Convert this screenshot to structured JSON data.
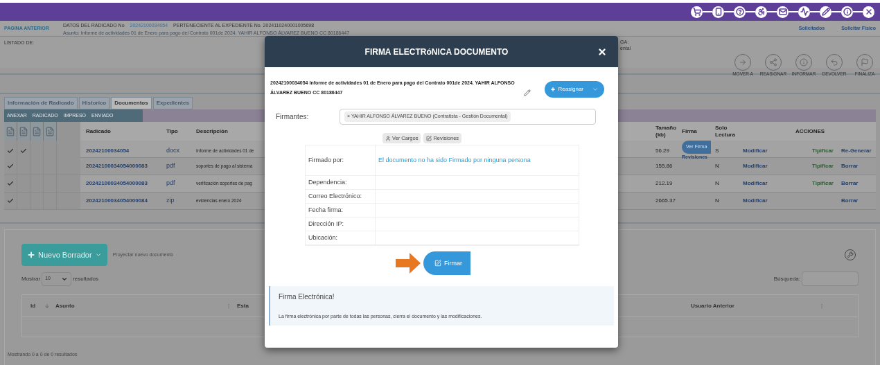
{
  "header": {
    "back_link": "PAGINA ANTERIOR",
    "radicado_label": "DATOS DEL RADICADO No",
    "radicado_number": "20242100034054",
    "expediente": "PERTENECIENTE AL EXPEDIENTE No. 2024110240001005698",
    "asunto": "Asunto: Informe de actividades 01 de Enero para pago del Contrato 001de 2024. YAHIR ALFONSO ÁLVAREZ BUENO CC 80186447",
    "links": [
      "Solicitados",
      "Solicitar Físico"
    ]
  },
  "listado": {
    "label": "LISTADO DE:",
    "info_label": "GA:",
    "info_value": "ental"
  },
  "workflow": [
    "MOVER A",
    "REASIGNAR",
    "INFORMAR",
    "DEVOLVER",
    "FINALIZA"
  ],
  "tabs": [
    {
      "label": "Información de Radicado",
      "selected": false
    },
    {
      "label": "Historico",
      "selected": false
    },
    {
      "label": "Documentos",
      "selected": true
    },
    {
      "label": "Expedientes",
      "selected": false
    }
  ],
  "doc_toolbar": [
    "ANEXAR",
    "RADICADO",
    "IMPRESO",
    "ENVIADO"
  ],
  "documents": {
    "columns": [
      "Radicado",
      "Tipo",
      "Descripción",
      "Tamaño (kb)",
      "Firma",
      "Solo Lectura",
      "ACCIONES"
    ],
    "rows": [
      {
        "checks": [
          true,
          true,
          false,
          false
        ],
        "radicado": "20242100034054",
        "tipo": "docx",
        "descripcion": "Informe de actividades 01 de",
        "tamano": "56.29",
        "firma": {
          "button": "Ver Firma",
          "link": "Revisiones"
        },
        "solo": "S",
        "modify": "Modificar",
        "typify": "Tipificar",
        "extra": "Re-Generar"
      },
      {
        "checks": [
          true,
          false,
          false,
          false
        ],
        "radicado": "20242100034054000083",
        "tipo": "pdf",
        "descripcion": "soportes de pago al sistema",
        "tamano": "155.86",
        "solo": "N",
        "modify": "Modificar",
        "typify": "Tipificar",
        "extra": "Borrar"
      },
      {
        "checks": [
          true,
          false,
          false,
          false
        ],
        "radicado": "20242100034054000083",
        "tipo": "pdf",
        "descripcion": "verificación soportes de pag",
        "tamano": "212.19",
        "solo": "N",
        "modify": "Modificar",
        "typify": "Tipificar",
        "extra": "Borrar"
      },
      {
        "checks": [
          true,
          false,
          false,
          false
        ],
        "radicado": "20242100034054000084",
        "tipo": "zip",
        "descripcion": "evidencias enero 2024",
        "tamano": "2665.37",
        "solo": "N",
        "modify": "Modificar",
        "extra": "Borrar"
      }
    ]
  },
  "drafts": {
    "new_button": "Nuevo Borrador",
    "hint": "Proyectar nuevo documento",
    "show_label": "Mostrar",
    "page_size": "10",
    "show_suffix": "resultados",
    "search_label": "Búsqueda:",
    "columns": [
      "Id",
      "Asunto",
      "Esta",
      "Usuario Anterior"
    ],
    "footer": "Mostrando 0 a 0 de 0 resultados"
  },
  "modal": {
    "title": "FIRMA ELECTRóNICA DOCUMENTO",
    "document_title": "20242100034054 Informe de actividades 01 de Enero para pago del Contrato 001de 2024. YAHIR ALFONSO ÁLVAREZ BUENO CC 80186447",
    "reassign_button": "Reasignar",
    "signers_label": "Firmantes:",
    "signers": [
      {
        "remove": "×",
        "name": "YAHIR ALFONSO ÁLVAREZ BUENO (Contratista - Gestión Documental)"
      }
    ],
    "buttons": [
      "Ver Cargos",
      "Revisiones"
    ],
    "details": [
      {
        "label": "Firmado por:",
        "value": "El documento no ha sido Firmado por ninguna persona"
      },
      {
        "label": "Dependencia:"
      },
      {
        "label": "Correo Electrónico:"
      },
      {
        "label": "Fecha firma:"
      },
      {
        "label": "Dirección IP:"
      },
      {
        "label": "Ubicación:"
      }
    ],
    "sign_button": "Firmar",
    "alert": {
      "title": "Firma Electrónica!",
      "text": "La firma electrónica por parte de todas las personas, cierra el documento y las modificaciones."
    }
  }
}
